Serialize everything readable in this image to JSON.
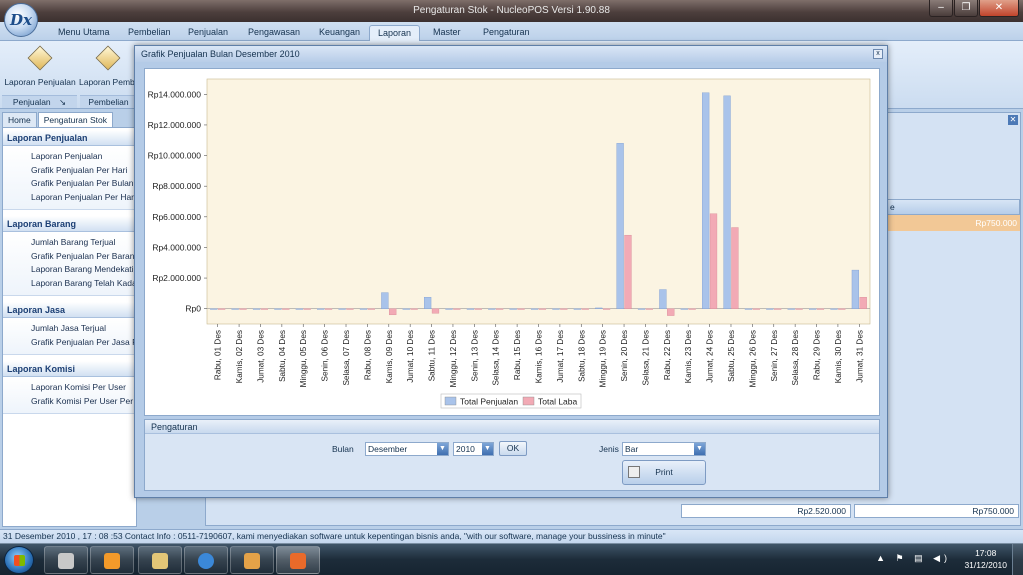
{
  "window": {
    "title": "Pengaturan Stok - NucleoPOS Versi 1.90.88",
    "orb_text": "Dx",
    "min": "–",
    "max": "❐",
    "close": "✕"
  },
  "ribbon": {
    "tabs": [
      "Menu Utama",
      "Pembelian",
      "Penjualan",
      "Pengawasan",
      "Keuangan",
      "Laporan",
      "Master",
      "Pengaturan"
    ],
    "active_tab": "Laporan",
    "buttons": [
      "Laporan Penjualan",
      "Laporan Pembelian"
    ],
    "groups": [
      "Penjualan",
      "Pembelian"
    ]
  },
  "nav": {
    "tabs": [
      "Home",
      "Pengaturan Stok"
    ],
    "sections": [
      {
        "title": "Laporan Penjualan",
        "items": [
          "Laporan Penjualan",
          "Grafik Penjualan Per Hari",
          "Grafik Penjualan Per Bulan",
          "Laporan Penjualan Per Hari"
        ]
      },
      {
        "title": "Laporan Barang",
        "items": [
          "Jumlah Barang Terjual",
          "Grafik Penjualan Per Barang",
          "Laporan Barang Mendekati K",
          "Laporan Barang Telah Kadalu"
        ]
      },
      {
        "title": "Laporan Jasa",
        "items": [
          "Jumlah Jasa Terjual",
          "Grafik Penjualan Per Jasa Per"
        ]
      },
      {
        "title": "Laporan Komisi",
        "items": [
          "Laporan Komisi Per User",
          "Grafik Komisi Per User Per Ha"
        ]
      }
    ]
  },
  "background_grid": {
    "header_fragment": "e",
    "row_value": "Rp750.000",
    "sum_left": "Rp2.520.000",
    "sum_right": "Rp750.000"
  },
  "dialog": {
    "title": "Grafik Penjualan Bulan Desember 2010",
    "close": "x",
    "settings": {
      "header": "Pengaturan",
      "bulan_label": "Bulan",
      "bulan_value": "Desember",
      "tahun_value": "2010",
      "ok_label": "OK",
      "jenis_label": "Jenis",
      "jenis_value": "Bar",
      "print_label": "Print"
    }
  },
  "chart_data": {
    "type": "bar",
    "title": "",
    "ylim": [
      -1000000,
      15000000
    ],
    "yticks": [
      "Rp0",
      "Rp2.000.000",
      "Rp4.000.000",
      "Rp6.000.000",
      "Rp8.000.000",
      "Rp10.000.000",
      "Rp12.000.000",
      "Rp14.000.000"
    ],
    "ytick_values": [
      0,
      2000000,
      4000000,
      6000000,
      8000000,
      10000000,
      12000000,
      14000000
    ],
    "categories": [
      "Rabu, 01 Des",
      "Kamis, 02 Des",
      "Jumat, 03 Des",
      "Sabtu, 04 Des",
      "Minggu, 05 Des",
      "Senin, 06 Des",
      "Selasa, 07 Des",
      "Rabu, 08 Des",
      "Kamis, 09 Des",
      "Jumat, 10 Des",
      "Sabtu, 11 Des",
      "Minggu, 12 Des",
      "Senin, 13 Des",
      "Selasa, 14 Des",
      "Rabu, 15 Des",
      "Kamis, 16 Des",
      "Jumat, 17 Des",
      "Sabtu, 18 Des",
      "Minggu, 19 Des",
      "Senin, 20 Des",
      "Selasa, 21 Des",
      "Rabu, 22 Des",
      "Kamis, 23 Des",
      "Jumat, 24 Des",
      "Sabtu, 25 Des",
      "Minggu, 26 Des",
      "Senin, 27 Des",
      "Selasa, 28 Des",
      "Rabu, 29 Des",
      "Kamis, 30 Des",
      "Jumat, 31 Des"
    ],
    "series": [
      {
        "name": "Total Penjualan",
        "color": "#a9c3ea",
        "values": [
          0,
          0,
          0,
          0,
          0,
          0,
          0,
          0,
          1050000,
          0,
          750000,
          0,
          0,
          0,
          0,
          0,
          0,
          0,
          50000,
          10800000,
          0,
          1250000,
          0,
          14100000,
          13900000,
          0,
          0,
          0,
          0,
          0,
          2520000
        ]
      },
      {
        "name": "Total Laba",
        "color": "#f2aab5",
        "values": [
          0,
          0,
          0,
          0,
          0,
          0,
          0,
          0,
          -400000,
          0,
          -300000,
          0,
          0,
          0,
          0,
          0,
          0,
          0,
          -50000,
          4800000,
          0,
          -450000,
          0,
          6200000,
          5300000,
          0,
          0,
          0,
          0,
          0,
          750000
        ]
      }
    ],
    "legend": "bottom-center",
    "grid": false
  },
  "statusbar": {
    "text": "31 Desember 2010 , 17 : 08 :53  Contact Info : 0511-7190607, kami menyediakan software untuk kepentingan bisnis anda, \"with our software, manage your bussiness in minute\""
  },
  "taskbar": {
    "time": "17:08",
    "date": "31/12/2010",
    "tray_icons": [
      "arrow-up-icon",
      "flag-icon",
      "network-icon",
      "volume-icon"
    ]
  }
}
